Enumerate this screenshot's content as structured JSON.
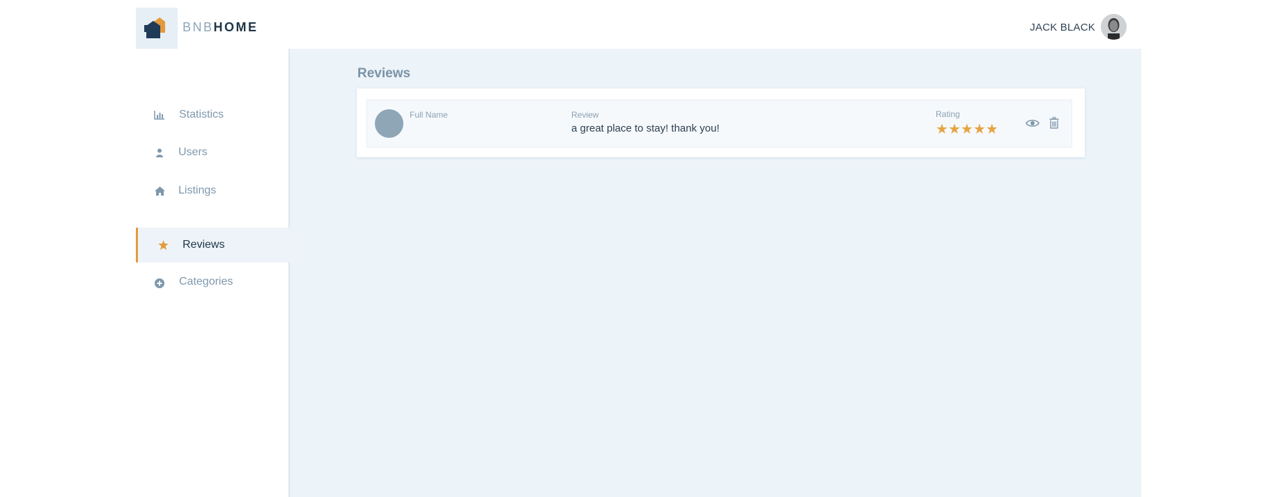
{
  "header": {
    "logo_text_light": "BNB",
    "logo_text_bold": "HOME",
    "user_name": "JACK BLACK"
  },
  "sidebar": {
    "items": [
      {
        "label": "Statistics",
        "icon": "bar-chart-icon",
        "active": false
      },
      {
        "label": "Users",
        "icon": "user-icon",
        "active": false
      },
      {
        "label": "Listings",
        "icon": "home-icon",
        "active": false
      },
      {
        "label": "Reviews",
        "icon": "star-icon",
        "active": true
      },
      {
        "label": "Categories",
        "icon": "plus-circle-icon",
        "active": false
      }
    ]
  },
  "main": {
    "title": "Reviews",
    "reviews": [
      {
        "name_label": "Full Name",
        "review_label": "Review",
        "review_text": "a great place to stay! thank you!",
        "rating_label": "Rating",
        "rating": 5,
        "rating_max": 5,
        "actions": [
          "eye-icon",
          "trash-icon"
        ]
      }
    ]
  },
  "colors": {
    "accent": "#e39a3d",
    "sidebar_active_bg": "#edf3f8",
    "main_bg": "#ecf3f9",
    "text_muted": "#7f98ac",
    "text_dark": "#1f3547"
  }
}
